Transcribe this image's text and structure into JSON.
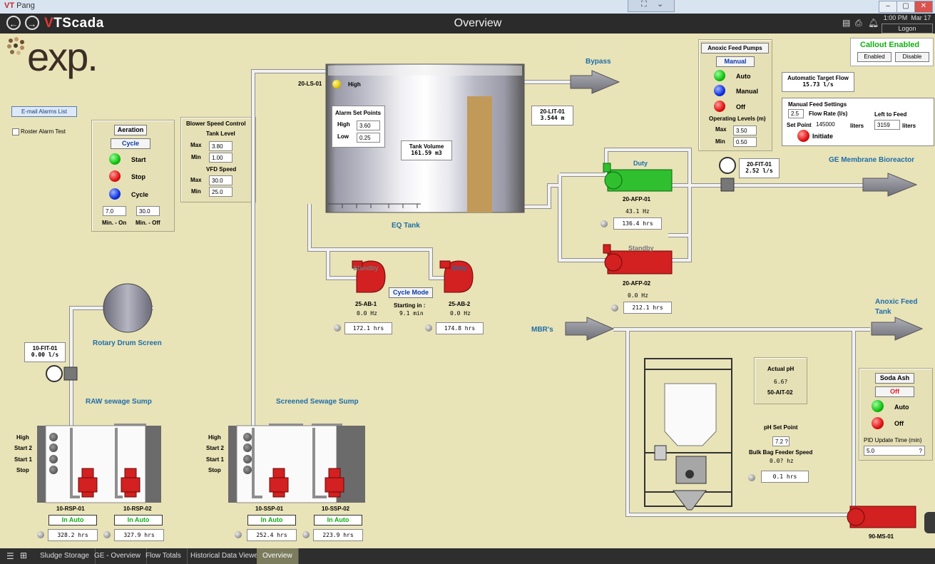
{
  "window": {
    "app_prefix": "VT",
    "title": "Pang"
  },
  "header": {
    "title": "Overview",
    "brand": "VTScada",
    "time": "1:00 PM",
    "date": "Mar 17",
    "logon_label": "Logon"
  },
  "company_logo": "exp.",
  "email_alarms_button": "E-mail Alarms List",
  "roster_alarm_test_label": "Roster Alarm Test",
  "callout": {
    "title": "Callout Enabled",
    "enabled_btn": "Enabled",
    "disable_btn": "Disable"
  },
  "aeration": {
    "title": "Aeration",
    "mode": "Cycle",
    "start": "Start",
    "stop": "Stop",
    "cycle": "Cycle",
    "min_on_value": "7.0",
    "min_off_value": "30.0",
    "min_on_label": "Min. - On",
    "min_off_label": "Min. - Off"
  },
  "blower": {
    "title": "Blower Speed Control",
    "tank_level": "Tank Level",
    "max_label": "Max",
    "min_label": "Min",
    "tank_max": "3.80",
    "tank_min": "1.00",
    "vfd_speed": "VFD Speed",
    "vfd_max": "30.0",
    "vfd_min": "25.0"
  },
  "eq_tank": {
    "ls_tag": "20-LS-01",
    "ls_state": "High",
    "alarm_title": "Alarm Set Points",
    "high_label": "High",
    "high_value": "3.60",
    "low_label": "Low",
    "low_value": "0.25",
    "volume_label": "Tank Volume",
    "volume_value": "161.59 m3",
    "name": "EQ Tank",
    "lit_tag": "20-LIT-01",
    "lit_value": "3.544 m"
  },
  "bypass_label": "Bypass",
  "blowers": {
    "standby_label": "Standby",
    "duty_label": "Duty",
    "ab1_tag": "25-AB-1",
    "ab1_hz": "0.0 Hz",
    "ab1_hrs": "172.1 hrs",
    "ab2_tag": "25-AB-2",
    "ab2_hz": "0.0 Hz",
    "ab2_hrs": "174.8 hrs",
    "cycle_mode": "Cycle Mode",
    "starting_in": "Starting in :",
    "starting_val": "9.1 min"
  },
  "anoxic_pumps": {
    "title": "Anoxic Feed Pumps",
    "mode": "Manual",
    "auto": "Auto",
    "manual": "Manual",
    "off": "Off",
    "op_levels": "Operating Levels (m)",
    "max_label": "Max",
    "min_label": "Min",
    "max_value": "3.50",
    "min_value": "0.50"
  },
  "target_flow": {
    "title": "Automatic Target Flow",
    "value": "15.73 l/s"
  },
  "manual_feed": {
    "title": "Manual Feed Settings",
    "flow_value": "2.5",
    "flow_label": "Flow Rate (l/s)",
    "left_label": "Left to Feed",
    "setpoint_label": "Set Point",
    "setpoint_value": "145000",
    "liters1": "liters",
    "left_value": "3159",
    "liters2": "liters",
    "initiate": "Initiate"
  },
  "afp": {
    "duty_label": "Duty",
    "afp1_tag": "20-AFP-01",
    "afp1_hz": "43.1 Hz",
    "afp1_hrs": "136.4 hrs",
    "standby_label": "Standby",
    "afp2_tag": "20-AFP-02",
    "afp2_hz": "0.0 Hz",
    "afp2_hrs": "212.1 hrs"
  },
  "fit20": {
    "tag": "20-FIT-01",
    "value": "2.52 l/s"
  },
  "ge_label": "GE Membrane Bioreactor",
  "anoxic_tank_label_1": "Anoxic Feed",
  "anoxic_tank_label_2": "Tank",
  "mbr_label": "MBR's",
  "ph": {
    "actual_label": "Actual pH",
    "actual_value": "6.6?",
    "tag": "50-AIT-02",
    "setpoint_label": "pH Set Point",
    "setpoint_value": "7.2 ?",
    "feeder_label": "Bulk Bag Feeder Speed",
    "feeder_value": "0.0? hz",
    "hrs": "0.1 hrs"
  },
  "soda_ash": {
    "title": "Soda Ash",
    "state": "Off",
    "auto": "Auto",
    "off": "Off",
    "pid_label": "PID Update Time (min)",
    "pid_value": "5.0",
    "pid_unit": "?"
  },
  "ms": {
    "tag": "90-MS-01"
  },
  "fit10": {
    "tag": "10-FIT-01",
    "value": "0.00 l/s"
  },
  "drum_label": "Rotary Drum Screen",
  "raw_sump": {
    "title": "RAW sewage Sump",
    "high": "High",
    "start2": "Start 2",
    "start1": "Start 1",
    "stop": "Stop",
    "p1_tag": "10-RSP-01",
    "p2_tag": "10-RSP-02",
    "p1_mode": "In Auto",
    "p2_mode": "In Auto",
    "p1_hrs": "328.2 hrs",
    "p2_hrs": "327.9 hrs"
  },
  "screened_sump": {
    "title": "Screened Sewage Sump",
    "high": "High",
    "start2": "Start 2",
    "start1": "Start 1",
    "stop": "Stop",
    "p1_tag": "10-SSP-01",
    "p2_tag": "10-SSP-02",
    "p1_mode": "In Auto",
    "p2_mode": "In Auto",
    "p1_hrs": "252.4 hrs",
    "p2_hrs": "223.9 hrs"
  },
  "tabs": [
    "Sludge Storage",
    "GE - Overview",
    "Flow Totals",
    "Historical Data Viewer",
    "Overview"
  ],
  "colors": {
    "background": "#e9e3b8",
    "pump_red": "#d32020",
    "pump_green": "#2fbf2f",
    "label_blue": "#1f6ea8"
  }
}
